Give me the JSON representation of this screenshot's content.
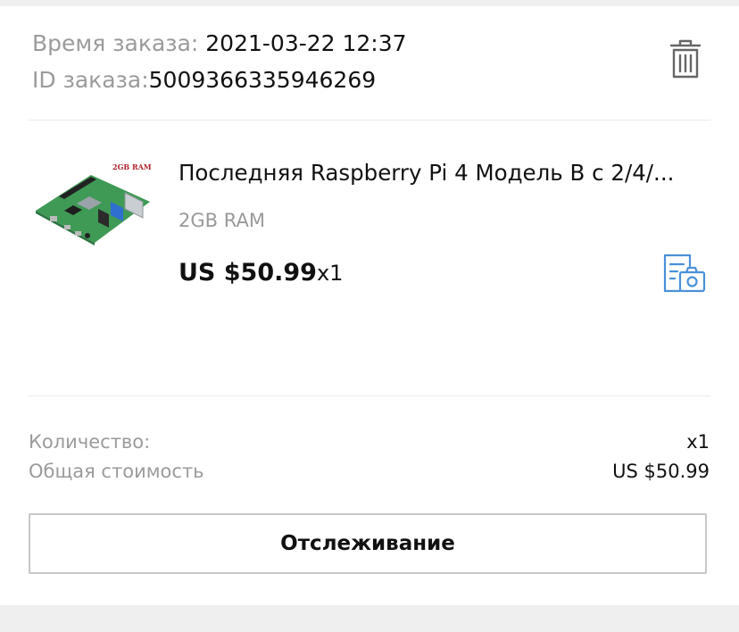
{
  "order": {
    "time_label": "Время заказа: ",
    "time_value": "2021-03-22 12:37",
    "id_label": "ID заказа:",
    "id_value": "5009366335946269"
  },
  "product": {
    "title": "Последняя Raspberry Pi 4 Модель B с 2/4/...",
    "image_caption": "2GB RAM",
    "variant": "2GB RAM",
    "price": "US $50.99",
    "quantity": "x1"
  },
  "summary": {
    "quantity_label": "Количество:",
    "quantity_value": "x1",
    "total_label": "Общая стоимость",
    "total_value": "US $50.99"
  },
  "actions": {
    "track_label": "Отслеживание"
  },
  "icons": {
    "delete": "trash-icon",
    "review": "photo-review-icon"
  },
  "colors": {
    "accent_blue": "#4a90d9",
    "label_gray": "#9b9b9b",
    "board_green": "#3f9a55"
  }
}
